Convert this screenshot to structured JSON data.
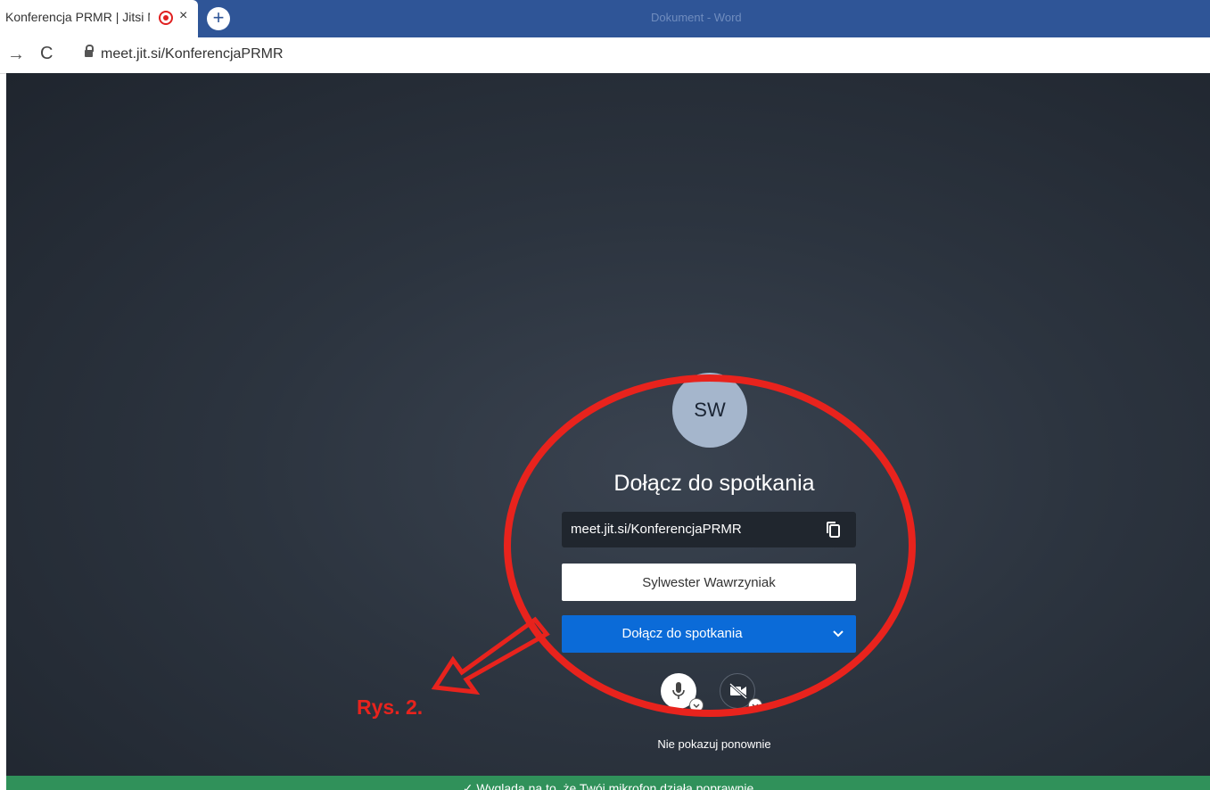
{
  "browser": {
    "tab_title": "Konferencja PRMR | Jitsi Mee",
    "tab_close": "×",
    "new_tab": "+",
    "window_title": "Dokument - Word",
    "url": "meet.jit.si/KonferencjaPRMR"
  },
  "prejoin": {
    "avatar_initials": "SW",
    "title": "Dołącz do spotkania",
    "meeting_url": "meet.jit.si/KonferencjaPRMR",
    "name_value": "Sylwester Wawrzyniak",
    "join_label": "Dołącz do spotkania",
    "dont_show_label": "Nie pokazuj ponownie"
  },
  "notification": {
    "text": "✓  Wygląda na to, że Twój mikrofon działa poprawnie"
  },
  "annotation": {
    "label": "Rys. 2.",
    "color": "#e8231d"
  },
  "colors": {
    "tabbar": "#2f5597",
    "join_button": "#0b6bd8",
    "notification": "#30915a",
    "avatar": "#a5b6cc"
  }
}
